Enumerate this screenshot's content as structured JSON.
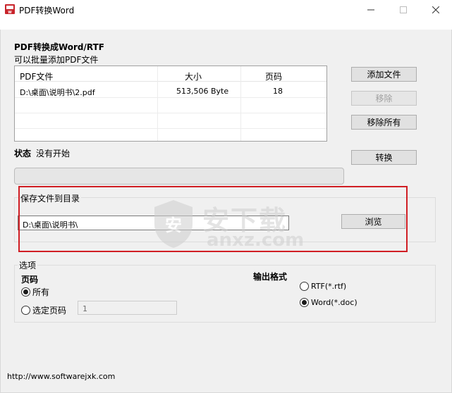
{
  "window": {
    "title": "PDF转换Word",
    "app_icon": "pdf-app-icon"
  },
  "convert_section": {
    "title": "PDF转换成Word/RTF",
    "subtitle": "可以批量添加PDF文件"
  },
  "file_list": {
    "columns": [
      "PDF文件",
      "大小",
      "页码"
    ],
    "rows": [
      {
        "file": "D:\\桌面\\说明书\\2.pdf",
        "size": "513,506 Byte",
        "pages": "18"
      }
    ]
  },
  "buttons": {
    "add_file": "添加文件",
    "remove": "移除",
    "remove_all": "移除所有",
    "convert": "转换",
    "browse": "浏览"
  },
  "status": {
    "label": "状态",
    "value": "没有开始",
    "progress": 0
  },
  "save_section": {
    "label": "保存文件到目录",
    "path": "D:\\桌面\\说明书\\"
  },
  "options": {
    "label": "选项",
    "pages_label": "页码",
    "all_label": "所有",
    "selected_label": "选定页码",
    "selected_value": "1",
    "pages_mode": "all",
    "output_label": "输出格式",
    "rtf_label": "RTF(*.rtf)",
    "word_label": "Word(*.doc)",
    "output_format": "word"
  },
  "watermark": {
    "big": "安下载",
    "small": "anxz.com"
  },
  "footer": {
    "url": "http://www.softwarejxk.com"
  },
  "colors": {
    "highlight": "#d01e24",
    "app_icon_red": "#c8242b"
  }
}
